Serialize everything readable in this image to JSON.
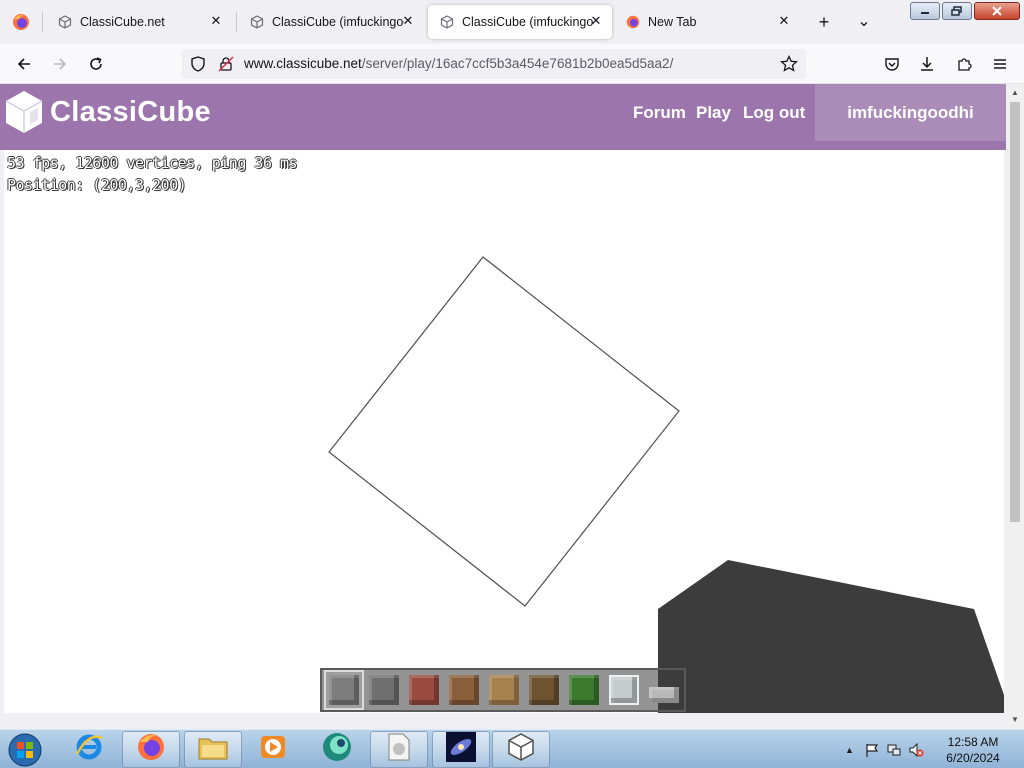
{
  "browser": {
    "tabs": [
      {
        "title": "ClassiCube.net",
        "active": false,
        "icon": "classicube-icon"
      },
      {
        "title": "ClassiCube (imfuckingoodhi)",
        "active": false,
        "icon": "classicube-icon"
      },
      {
        "title": "ClassiCube (imfuckingoodhi)",
        "active": true,
        "icon": "classicube-icon"
      },
      {
        "title": "New Tab",
        "active": false,
        "icon": "firefox-icon"
      }
    ],
    "close_glyph": "✕",
    "new_tab_glyph": "+",
    "tab_list_glyph": "⌄",
    "url_host": "www.classicube.net",
    "url_path": "/server/play/16ac7ccf5b3a454e7681b2b0ea5d5aa2/"
  },
  "site": {
    "logo": "ClassiCube",
    "nav": [
      {
        "label": "Forum"
      },
      {
        "label": "Play"
      },
      {
        "label": "Log out"
      }
    ],
    "username": "imfuckingoodhi"
  },
  "game": {
    "stats_line": "53 fps, 12600 vertices, ping 36 ms",
    "position_line": "Position: (200,3,200)",
    "hotbar": [
      {
        "block": "stone",
        "selected": true,
        "color": "#7d7d7d"
      },
      {
        "block": "cobblestone",
        "selected": false,
        "color": "#6f6f6f"
      },
      {
        "block": "brick",
        "selected": false,
        "color": "#9a4a3e"
      },
      {
        "block": "dirt",
        "selected": false,
        "color": "#8b5e3a"
      },
      {
        "block": "wood-planks",
        "selected": false,
        "color": "#a8824e"
      },
      {
        "block": "log",
        "selected": false,
        "color": "#6e5330"
      },
      {
        "block": "leaves",
        "selected": false,
        "color": "#3b7a2c"
      },
      {
        "block": "glass",
        "selected": false,
        "color": "#d8e4e8"
      },
      {
        "block": "slab",
        "selected": false,
        "color": "#b8b8b8"
      }
    ],
    "colors": {
      "ground": "#3c3c3c",
      "outline": "#505050"
    }
  },
  "taskbar": {
    "items": [
      {
        "name": "internet-explorer-icon",
        "running": false
      },
      {
        "name": "firefox-icon",
        "running": true
      },
      {
        "name": "file-explorer-icon",
        "running": true
      },
      {
        "name": "media-player-icon",
        "running": false
      },
      {
        "name": "app-icon",
        "running": false
      },
      {
        "name": "document-icon",
        "running": true
      },
      {
        "name": "galaxy-icon",
        "running": true
      },
      {
        "name": "classicube-icon",
        "running": true
      }
    ],
    "time": "12:58 AM",
    "date": "6/20/2024"
  }
}
